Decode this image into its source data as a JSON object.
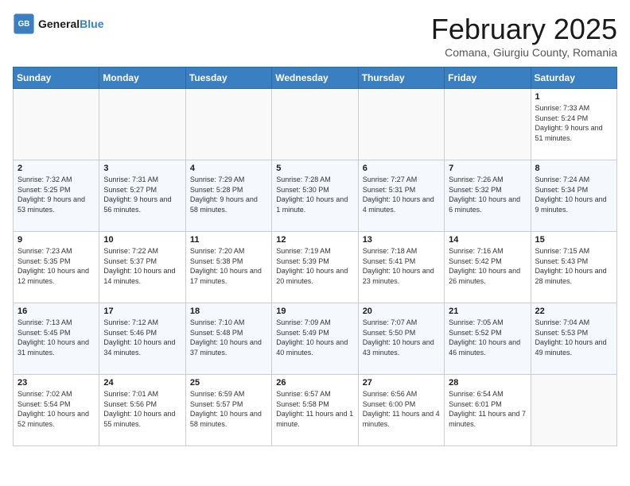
{
  "header": {
    "logo_line1": "General",
    "logo_line2": "Blue",
    "month": "February 2025",
    "location": "Comana, Giurgiu County, Romania"
  },
  "weekdays": [
    "Sunday",
    "Monday",
    "Tuesday",
    "Wednesday",
    "Thursday",
    "Friday",
    "Saturday"
  ],
  "weeks": [
    [
      {
        "day": "",
        "info": ""
      },
      {
        "day": "",
        "info": ""
      },
      {
        "day": "",
        "info": ""
      },
      {
        "day": "",
        "info": ""
      },
      {
        "day": "",
        "info": ""
      },
      {
        "day": "",
        "info": ""
      },
      {
        "day": "1",
        "info": "Sunrise: 7:33 AM\nSunset: 5:24 PM\nDaylight: 9 hours and 51 minutes."
      }
    ],
    [
      {
        "day": "2",
        "info": "Sunrise: 7:32 AM\nSunset: 5:25 PM\nDaylight: 9 hours and 53 minutes."
      },
      {
        "day": "3",
        "info": "Sunrise: 7:31 AM\nSunset: 5:27 PM\nDaylight: 9 hours and 56 minutes."
      },
      {
        "day": "4",
        "info": "Sunrise: 7:29 AM\nSunset: 5:28 PM\nDaylight: 9 hours and 58 minutes."
      },
      {
        "day": "5",
        "info": "Sunrise: 7:28 AM\nSunset: 5:30 PM\nDaylight: 10 hours and 1 minute."
      },
      {
        "day": "6",
        "info": "Sunrise: 7:27 AM\nSunset: 5:31 PM\nDaylight: 10 hours and 4 minutes."
      },
      {
        "day": "7",
        "info": "Sunrise: 7:26 AM\nSunset: 5:32 PM\nDaylight: 10 hours and 6 minutes."
      },
      {
        "day": "8",
        "info": "Sunrise: 7:24 AM\nSunset: 5:34 PM\nDaylight: 10 hours and 9 minutes."
      }
    ],
    [
      {
        "day": "9",
        "info": "Sunrise: 7:23 AM\nSunset: 5:35 PM\nDaylight: 10 hours and 12 minutes."
      },
      {
        "day": "10",
        "info": "Sunrise: 7:22 AM\nSunset: 5:37 PM\nDaylight: 10 hours and 14 minutes."
      },
      {
        "day": "11",
        "info": "Sunrise: 7:20 AM\nSunset: 5:38 PM\nDaylight: 10 hours and 17 minutes."
      },
      {
        "day": "12",
        "info": "Sunrise: 7:19 AM\nSunset: 5:39 PM\nDaylight: 10 hours and 20 minutes."
      },
      {
        "day": "13",
        "info": "Sunrise: 7:18 AM\nSunset: 5:41 PM\nDaylight: 10 hours and 23 minutes."
      },
      {
        "day": "14",
        "info": "Sunrise: 7:16 AM\nSunset: 5:42 PM\nDaylight: 10 hours and 26 minutes."
      },
      {
        "day": "15",
        "info": "Sunrise: 7:15 AM\nSunset: 5:43 PM\nDaylight: 10 hours and 28 minutes."
      }
    ],
    [
      {
        "day": "16",
        "info": "Sunrise: 7:13 AM\nSunset: 5:45 PM\nDaylight: 10 hours and 31 minutes."
      },
      {
        "day": "17",
        "info": "Sunrise: 7:12 AM\nSunset: 5:46 PM\nDaylight: 10 hours and 34 minutes."
      },
      {
        "day": "18",
        "info": "Sunrise: 7:10 AM\nSunset: 5:48 PM\nDaylight: 10 hours and 37 minutes."
      },
      {
        "day": "19",
        "info": "Sunrise: 7:09 AM\nSunset: 5:49 PM\nDaylight: 10 hours and 40 minutes."
      },
      {
        "day": "20",
        "info": "Sunrise: 7:07 AM\nSunset: 5:50 PM\nDaylight: 10 hours and 43 minutes."
      },
      {
        "day": "21",
        "info": "Sunrise: 7:05 AM\nSunset: 5:52 PM\nDaylight: 10 hours and 46 minutes."
      },
      {
        "day": "22",
        "info": "Sunrise: 7:04 AM\nSunset: 5:53 PM\nDaylight: 10 hours and 49 minutes."
      }
    ],
    [
      {
        "day": "23",
        "info": "Sunrise: 7:02 AM\nSunset: 5:54 PM\nDaylight: 10 hours and 52 minutes."
      },
      {
        "day": "24",
        "info": "Sunrise: 7:01 AM\nSunset: 5:56 PM\nDaylight: 10 hours and 55 minutes."
      },
      {
        "day": "25",
        "info": "Sunrise: 6:59 AM\nSunset: 5:57 PM\nDaylight: 10 hours and 58 minutes."
      },
      {
        "day": "26",
        "info": "Sunrise: 6:57 AM\nSunset: 5:58 PM\nDaylight: 11 hours and 1 minute."
      },
      {
        "day": "27",
        "info": "Sunrise: 6:56 AM\nSunset: 6:00 PM\nDaylight: 11 hours and 4 minutes."
      },
      {
        "day": "28",
        "info": "Sunrise: 6:54 AM\nSunset: 6:01 PM\nDaylight: 11 hours and 7 minutes."
      },
      {
        "day": "",
        "info": ""
      }
    ]
  ]
}
